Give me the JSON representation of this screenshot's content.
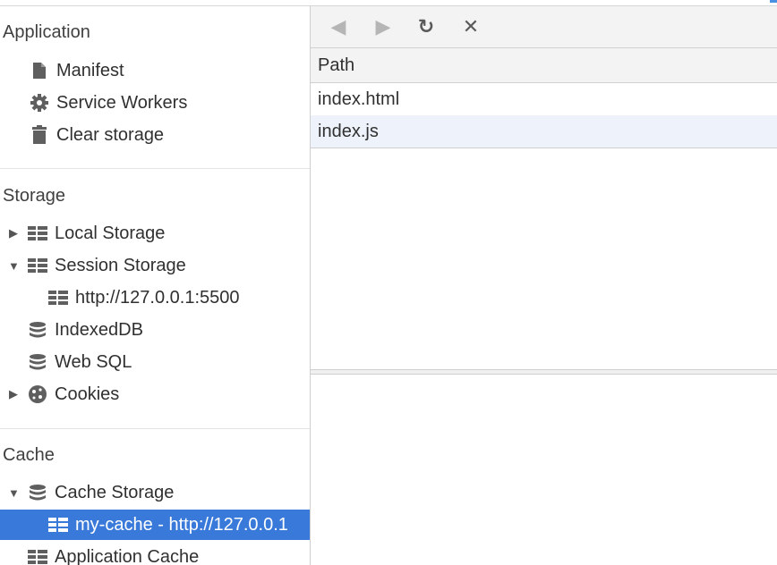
{
  "sidebar": {
    "application": {
      "title": "Application",
      "items": [
        {
          "label": "Manifest",
          "icon": "file-icon"
        },
        {
          "label": "Service Workers",
          "icon": "gear-icon"
        },
        {
          "label": "Clear storage",
          "icon": "trash-icon"
        }
      ]
    },
    "storage": {
      "title": "Storage",
      "items": [
        {
          "label": "Local Storage",
          "icon": "grid-icon",
          "expanded": false
        },
        {
          "label": "Session Storage",
          "icon": "grid-icon",
          "expanded": true
        },
        {
          "label": "http://127.0.0.1:5500",
          "icon": "grid-icon"
        },
        {
          "label": "IndexedDB",
          "icon": "database-icon"
        },
        {
          "label": "Web SQL",
          "icon": "database-icon"
        },
        {
          "label": "Cookies",
          "icon": "cookie-icon",
          "expanded": false
        }
      ]
    },
    "cache": {
      "title": "Cache",
      "items": [
        {
          "label": "Cache Storage",
          "icon": "database-icon",
          "expanded": true
        },
        {
          "label": "my-cache - http://127.0.0.1",
          "icon": "grid-icon",
          "selected": true
        },
        {
          "label": "Application Cache",
          "icon": "grid-icon"
        }
      ]
    }
  },
  "toolbar": {
    "back": "◀",
    "forward": "▶",
    "refresh": "↻",
    "delete": "✕"
  },
  "table": {
    "header": "Path",
    "rows": [
      "index.html",
      "index.js"
    ]
  },
  "colors": {
    "selected": "#3879d9",
    "row_alt": "#eef3fb"
  }
}
